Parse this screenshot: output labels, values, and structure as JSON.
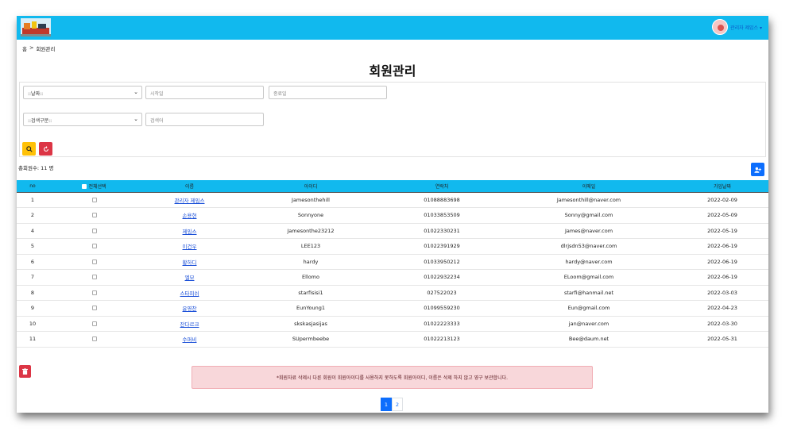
{
  "header": {
    "username": "관리자 제임스 ▾"
  },
  "breadcrumb": {
    "home": "홈",
    "sep": ">",
    "current": "회원관리"
  },
  "page_title": "회원관리",
  "search": {
    "filter1": "::날짜::",
    "start_placeholder": "시작일",
    "end_placeholder": "종료일",
    "filter2": "::검색구분::",
    "keyword_placeholder": "검색어"
  },
  "total_text": "총회원수: 11 명",
  "table": {
    "headers": {
      "no": "no",
      "select_all": "전체선택",
      "name": "이름",
      "id": "아이디",
      "phone": "연락처",
      "email": "이메일",
      "joined": "가입날짜"
    },
    "rows": [
      {
        "no": "1",
        "name": "관리자 제임스",
        "id": "Jamesonthehill",
        "phone": "01088883698",
        "email": "Jamesonthill@naver.com",
        "joined": "2022-02-09"
      },
      {
        "no": "2",
        "name": "손용현",
        "id": "Sonnyone",
        "phone": "01033853509",
        "email": "Sonny@gmail.com",
        "joined": "2022-05-09"
      },
      {
        "no": "4",
        "name": "제임스",
        "id": "Jamesonthe23212",
        "phone": "01022330231",
        "email": "James@naver.com",
        "joined": "2022-05-19"
      },
      {
        "no": "5",
        "name": "이건우",
        "id": "LEE123",
        "phone": "01022391929",
        "email": "dlrjsdn53@naver.com",
        "joined": "2022-06-19"
      },
      {
        "no": "6",
        "name": "황하디",
        "id": "hardy",
        "phone": "01033950212",
        "email": "hardy@naver.com",
        "joined": "2022-06-19"
      },
      {
        "no": "7",
        "name": "엘모",
        "id": "Ellomo",
        "phone": "01022932234",
        "email": "ELoom@gmail.com",
        "joined": "2022-06-19"
      },
      {
        "no": "8",
        "name": "스타피쉬",
        "id": "starfisisi1",
        "phone": "027522023",
        "email": "starfi@hanmail.net",
        "joined": "2022-03-03"
      },
      {
        "no": "9",
        "name": "윤영찬",
        "id": "EunYoung1",
        "phone": "01099559230",
        "email": "Eun@gmail.com",
        "joined": "2022-04-23"
      },
      {
        "no": "10",
        "name": "잔다르크",
        "id": "skskasjasijas",
        "phone": "01022223333",
        "email": "jan@naver.com",
        "joined": "2022-03-30"
      },
      {
        "no": "11",
        "name": "수퍼비",
        "id": "SUpermbeebe",
        "phone": "01022213123",
        "email": "Bee@daum.net",
        "joined": "2022-05-31"
      }
    ]
  },
  "notice": "*회원자료 삭제시 다른 회원이 회원아이디를 사용하지 못하도록 회원아이디, 이름은 삭제 하지 않고 영구 보관합니다.",
  "pagination": {
    "pages": [
      "1",
      "2"
    ],
    "current": "1"
  },
  "colors": {
    "header": "#11b9ee",
    "search_btn": "#ffc107",
    "reset_btn": "#dc3545",
    "primary": "#0d6efd"
  }
}
